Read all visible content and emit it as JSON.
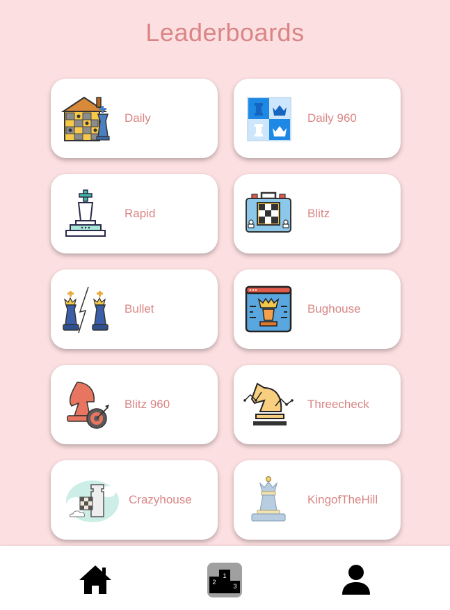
{
  "header": {
    "title": "Leaderboards"
  },
  "leaderboards": [
    {
      "label": "Daily",
      "icon": "daily-chessboard-house-icon"
    },
    {
      "label": "Daily 960",
      "icon": "daily960-tiles-icon"
    },
    {
      "label": "Rapid",
      "icon": "rapid-king-icon"
    },
    {
      "label": "Blitz",
      "icon": "blitz-clock-icon"
    },
    {
      "label": "Bullet",
      "icon": "bullet-kings-icon"
    },
    {
      "label": "Bughouse",
      "icon": "bughouse-rook-window-icon"
    },
    {
      "label": "Blitz 960",
      "icon": "blitz960-knight-target-icon"
    },
    {
      "label": "Threecheck",
      "icon": "threecheck-knight-icon"
    },
    {
      "label": "Crazyhouse",
      "icon": "crazyhouse-rook-cloud-icon"
    },
    {
      "label": "KingofTheHill",
      "icon": "king-of-the-hill-queen-icon"
    }
  ],
  "bottom_nav": {
    "items": [
      {
        "name": "home",
        "icon": "home-icon"
      },
      {
        "name": "leaderboards",
        "icon": "podium-icon",
        "active": true,
        "podium_numbers": [
          "1",
          "2",
          "3"
        ]
      },
      {
        "name": "profile",
        "icon": "user-icon"
      }
    ]
  },
  "colors": {
    "background": "#fcdfe1",
    "accent_text": "#d98585",
    "card": "#ffffff"
  }
}
